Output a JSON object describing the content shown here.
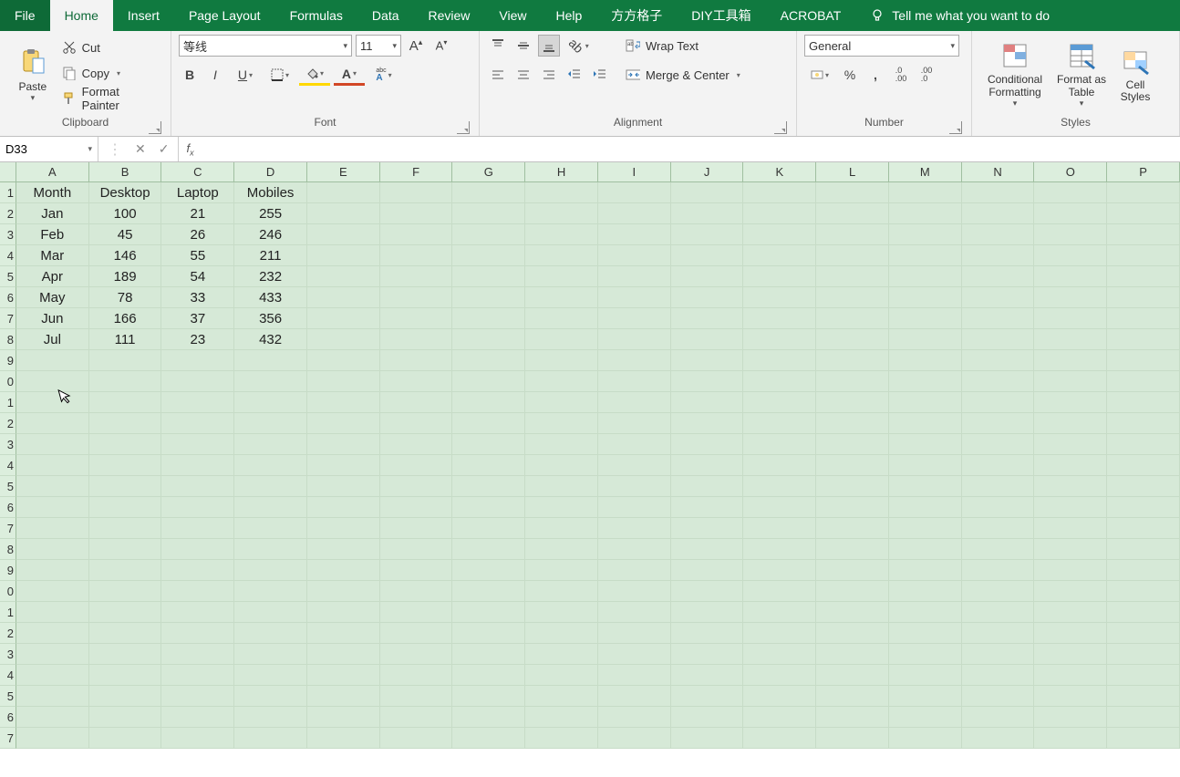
{
  "tabs": {
    "file": "File",
    "home": "Home",
    "insert": "Insert",
    "pageLayout": "Page Layout",
    "formulas": "Formulas",
    "data": "Data",
    "review": "Review",
    "view": "View",
    "help": "Help",
    "ffgz": "方方格子",
    "diy": "DIY工具箱",
    "acrobat": "ACROBAT",
    "tellme": "Tell me what you want to do"
  },
  "ribbon": {
    "clipboard": {
      "label": "Clipboard",
      "paste": "Paste",
      "cut": "Cut",
      "copy": "Copy",
      "formatPainter": "Format Painter"
    },
    "font": {
      "label": "Font",
      "name": "等线",
      "size": "11"
    },
    "alignment": {
      "label": "Alignment",
      "wrapText": "Wrap Text",
      "mergeCenter": "Merge & Center"
    },
    "number": {
      "label": "Number",
      "format": "General"
    },
    "styles": {
      "label": "Styles",
      "conditional": "Conditional Formatting",
      "formatAs": "Format as Table",
      "cellStyles": "Cell Styles"
    }
  },
  "formulaBar": {
    "nameBox": "D33",
    "formula": ""
  },
  "grid": {
    "columnLetters": [
      "A",
      "B",
      "C",
      "D",
      "E",
      "F",
      "G",
      "H",
      "I",
      "J",
      "K",
      "L",
      "M",
      "N",
      "O",
      "P"
    ],
    "rowNumbers": [
      "1",
      "2",
      "3",
      "4",
      "5",
      "6",
      "7",
      "8",
      "9",
      "0",
      "1",
      "2",
      "3",
      "4",
      "5",
      "6",
      "7",
      "8",
      "9",
      "0",
      "1",
      "2",
      "3",
      "4",
      "5",
      "6",
      "7"
    ],
    "headers": [
      "Month",
      "Desktop",
      "Laptop",
      "Mobiles"
    ],
    "data": [
      [
        "Jan",
        "100",
        "21",
        "255"
      ],
      [
        "Feb",
        "45",
        "26",
        "246"
      ],
      [
        "Mar",
        "146",
        "55",
        "211"
      ],
      [
        "Apr",
        "189",
        "54",
        "232"
      ],
      [
        "May",
        "78",
        "33",
        "433"
      ],
      [
        "Jun",
        "166",
        "37",
        "356"
      ],
      [
        "Jul",
        "111",
        "23",
        "432"
      ]
    ]
  }
}
